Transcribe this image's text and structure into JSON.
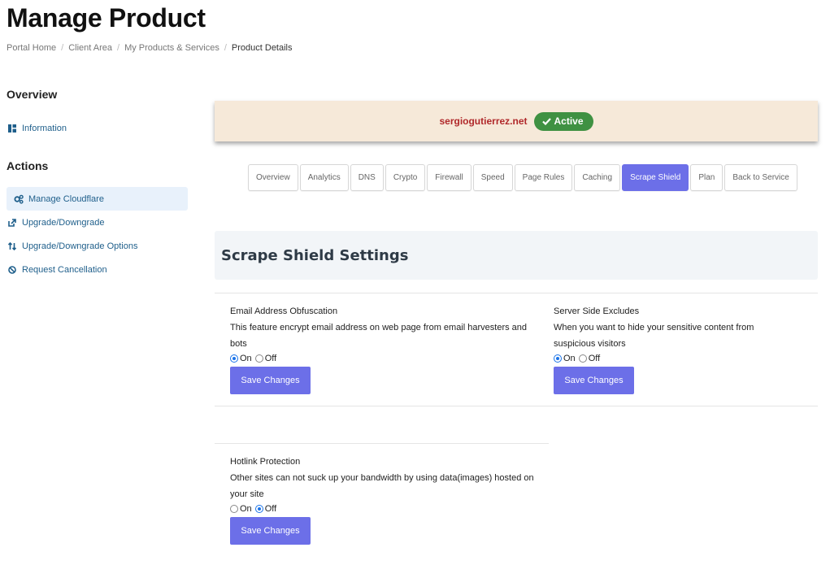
{
  "page": {
    "title": "Manage Product"
  },
  "breadcrumb": [
    "Portal Home",
    "Client Area",
    "My Products & Services",
    "Product Details"
  ],
  "sidebar": {
    "overview_heading": "Overview",
    "overview_items": [
      {
        "label": "Information",
        "icon": "grid-icon"
      }
    ],
    "actions_heading": "Actions",
    "action_items": [
      {
        "label": "Manage Cloudflare",
        "icon": "cogs-icon",
        "active": true
      },
      {
        "label": "Upgrade/Downgrade",
        "icon": "external-link-icon"
      },
      {
        "label": "Upgrade/Downgrade Options",
        "icon": "sort-arrows-icon"
      },
      {
        "label": "Request Cancellation",
        "icon": "ban-icon"
      }
    ]
  },
  "status": {
    "domain": "sergiogutierrez.net",
    "badge": "Active",
    "badge_color": "#3f9142"
  },
  "tabs": [
    "Overview",
    "Analytics",
    "DNS",
    "Crypto",
    "Firewall",
    "Speed",
    "Page Rules",
    "Caching",
    "Scrape Shield",
    "Plan",
    "Back to Service"
  ],
  "active_tab": "Scrape Shield",
  "accent_color": "#6c6fe8",
  "section": {
    "title": "Scrape Shield Settings"
  },
  "settings": [
    {
      "title": "Email Address Obfuscation",
      "description": "This feature encrypt email address on web page from email harvesters and bots",
      "on_label": "On",
      "off_label": "Off",
      "value": "On",
      "button": "Save Changes"
    },
    {
      "title": "Server Side Excludes",
      "description": "When you want to hide your sensitive content from suspicious visitors",
      "on_label": "On",
      "off_label": "Off",
      "value": "On",
      "button": "Save Changes"
    },
    {
      "title": "Hotlink Protection",
      "description": "Other sites can not suck up your bandwidth by using data(images) hosted on your site",
      "on_label": "On",
      "off_label": "Off",
      "value": "Off",
      "button": "Save Changes"
    }
  ]
}
